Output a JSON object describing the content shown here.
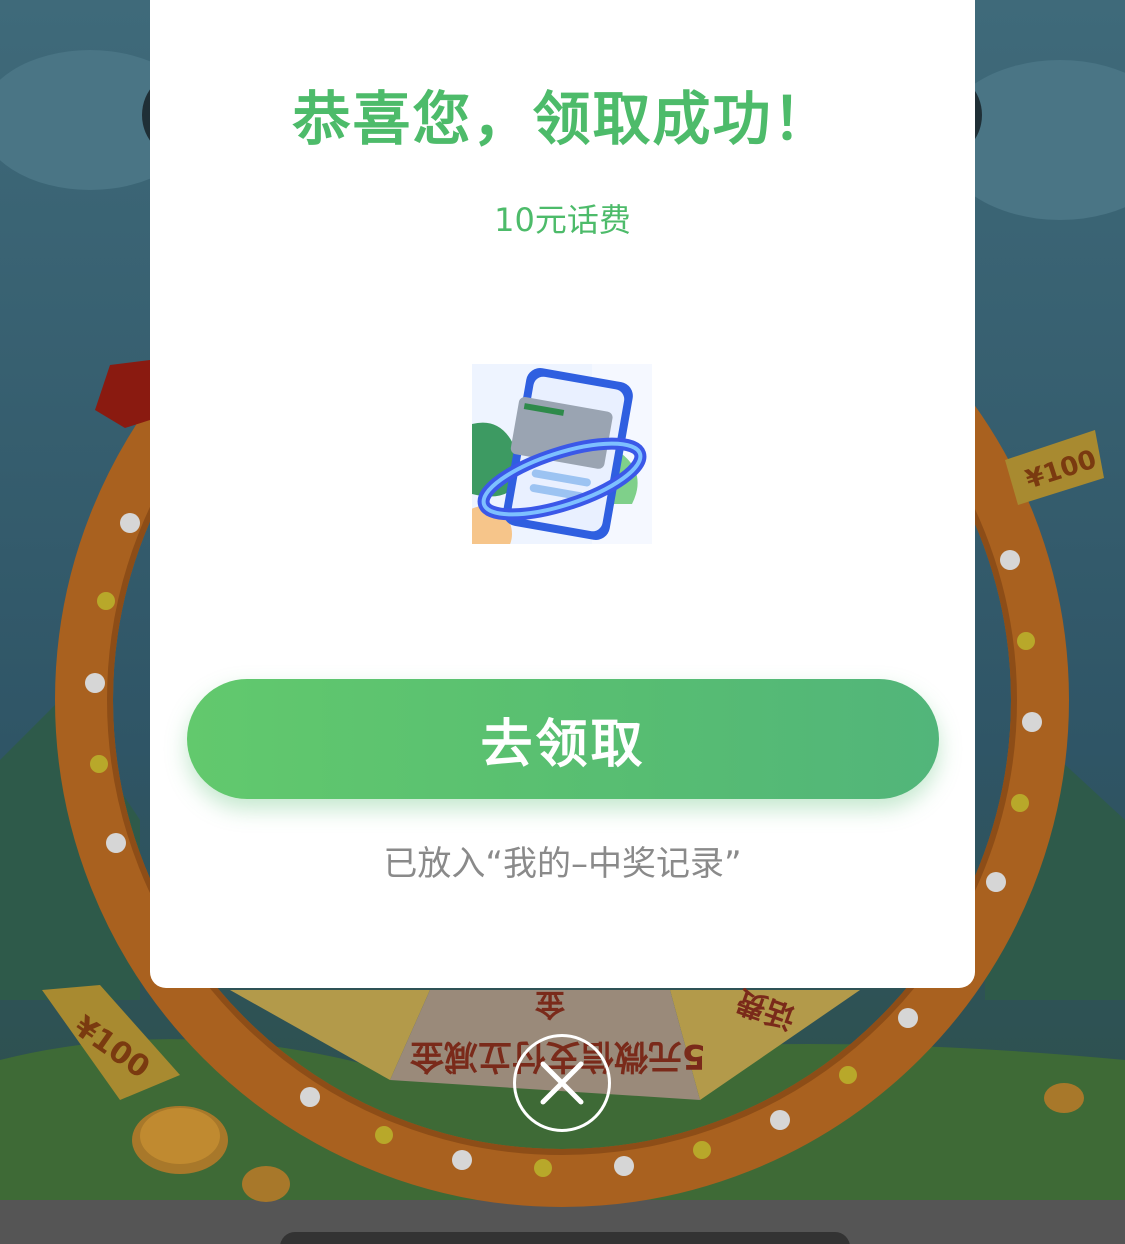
{
  "modal": {
    "title": "恭喜您，领取成功！",
    "prize_name": "10元话费",
    "claim_button_label": "去领取",
    "record_note": "已放入“我的–中奖记录”"
  },
  "wheel": {
    "segments": [
      "5元微信支付立减金",
      "话费",
      "金"
    ],
    "badge_text": "¥100"
  },
  "colors": {
    "accent_green": "#4dbb6a",
    "button_gradient_start": "#62c96d",
    "button_gradient_end": "#52b57a",
    "note_gray": "#8a8a8a",
    "wheel_orange": "#e0892a"
  },
  "icons": {
    "close": "close-icon",
    "prize": "phone-card-icon"
  }
}
